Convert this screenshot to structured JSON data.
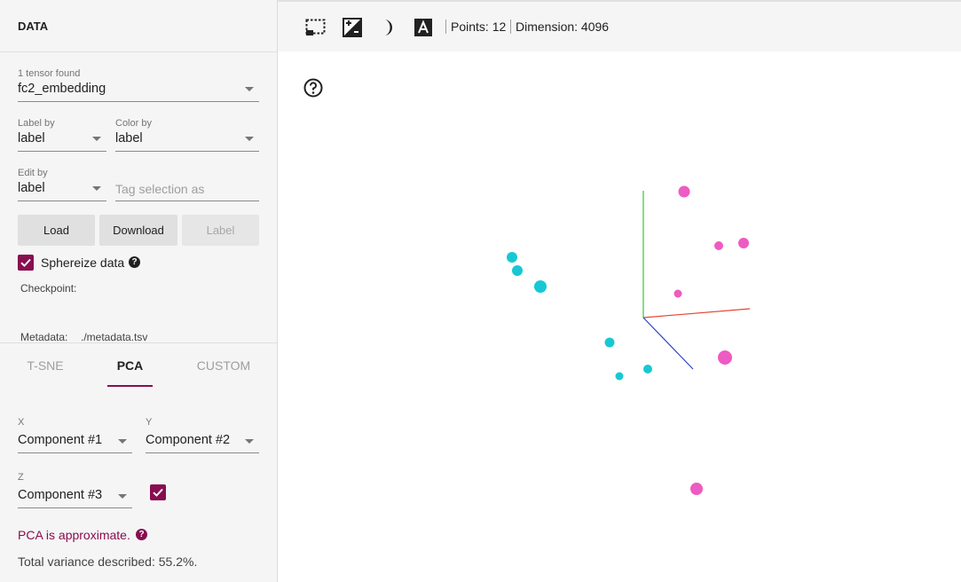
{
  "data_panel": {
    "title": "DATA",
    "tensor_count": "1 tensor found",
    "tensor": "fc2_embedding",
    "label_by": {
      "label": "Label by",
      "value": "label"
    },
    "color_by": {
      "label": "Color by",
      "value": "label"
    },
    "edit_by": {
      "label": "Edit by",
      "value": "label"
    },
    "tag_placeholder": "Tag selection as",
    "buttons": {
      "load": "Load",
      "download": "Download",
      "label": "Label"
    },
    "sphereize": {
      "label": "Sphereize data",
      "checked": true
    },
    "checkpoint_label": "Checkpoint:",
    "metadata_label": "Metadata:",
    "metadata_value": "./metadata.tsv"
  },
  "projection": {
    "tabs": [
      "T-SNE",
      "PCA",
      "CUSTOM"
    ],
    "active_tab": "PCA",
    "x": {
      "label": "X",
      "value": "Component #1"
    },
    "y": {
      "label": "Y",
      "value": "Component #2"
    },
    "z": {
      "label": "Z",
      "value": "Component #3",
      "enabled": true
    },
    "approx_note": "PCA is approximate.",
    "variance": "Total variance described: 55.2%."
  },
  "toolbar": {
    "icons": [
      "selection-box-icon",
      "night-mode-icon",
      "moon-icon",
      "labels-icon"
    ],
    "points": "Points: 12",
    "dimension": "Dimension: 4096"
  },
  "viewport": {
    "help_icon": "help-icon"
  },
  "colors": {
    "accent": "#880e4f",
    "cyan": "#17c8d3",
    "pink": "#ee5bc2"
  }
}
